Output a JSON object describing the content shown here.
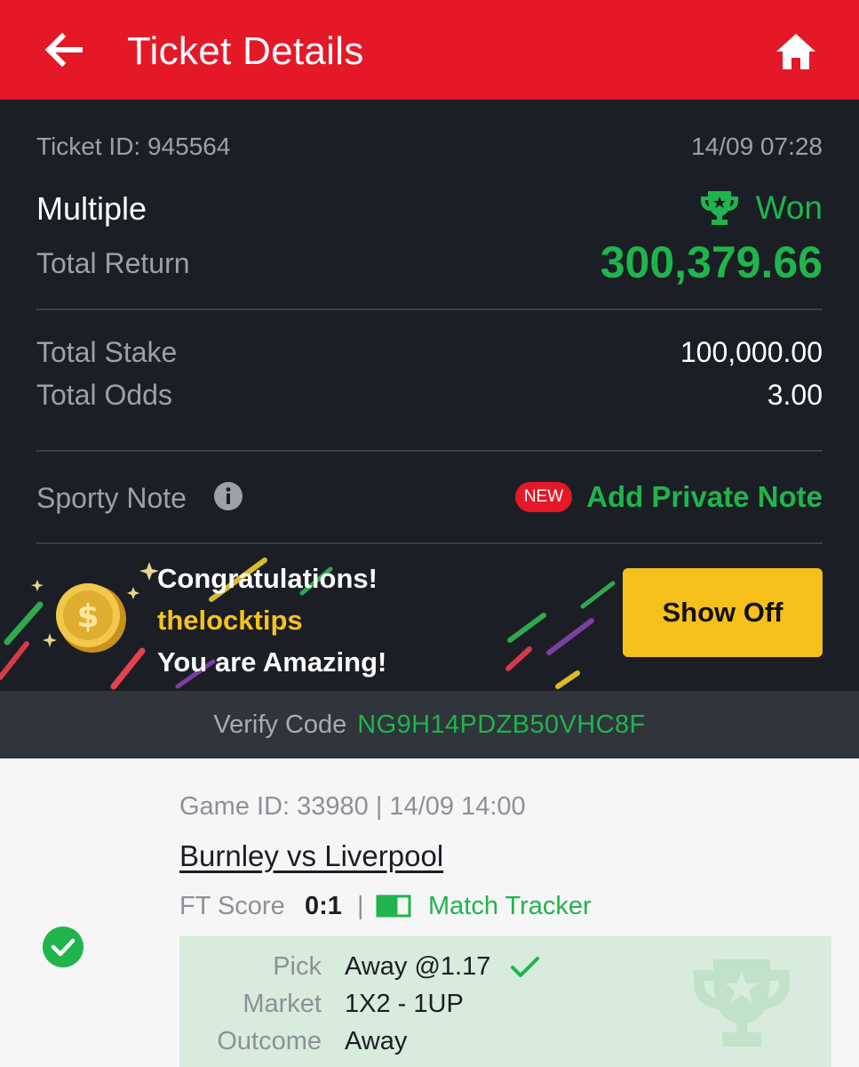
{
  "header": {
    "title": "Ticket Details",
    "back_icon": "arrow-left-icon",
    "home_icon": "home-icon"
  },
  "ticket": {
    "id_text": "Ticket ID: 945564",
    "datetime": "14/09 07:28",
    "bet_type": "Multiple",
    "status": "Won",
    "status_icon": "trophy-icon",
    "total_return_label": "Total Return",
    "total_return_value": "300,379.66",
    "total_stake_label": "Total Stake",
    "total_stake_value": "100,000.00",
    "total_odds_label": "Total Odds",
    "total_odds_value": "3.00"
  },
  "note": {
    "label": "Sporty Note",
    "info_icon": "info-icon",
    "badge": "NEW",
    "action": "Add Private Note"
  },
  "banner": {
    "line1": "Congratulations!",
    "username": "thelocktips",
    "line3": "You are Amazing!",
    "button": "Show Off"
  },
  "verify": {
    "label": "Verify Code",
    "code": "NG9H14PDZB50VHC8F"
  },
  "game": {
    "meta": "Game ID: 33980 | 14/09 14:00",
    "match": "Burnley vs Liverpool",
    "ft_label": "FT Score",
    "ft_score": "0:1",
    "separator": "|",
    "tracker": "Match Tracker",
    "pick_label": "Pick",
    "pick_value": "Away @1.17",
    "market_label": "Market",
    "market_value": "1X2 - 1UP",
    "outcome_label": "Outcome",
    "outcome_value": "Away"
  },
  "colors": {
    "header_red": "#e41827",
    "dark_bg": "#1b1e25",
    "green": "#1fb54c",
    "yellow": "#f6c01b",
    "pick_bg": "#d7ecdc"
  }
}
